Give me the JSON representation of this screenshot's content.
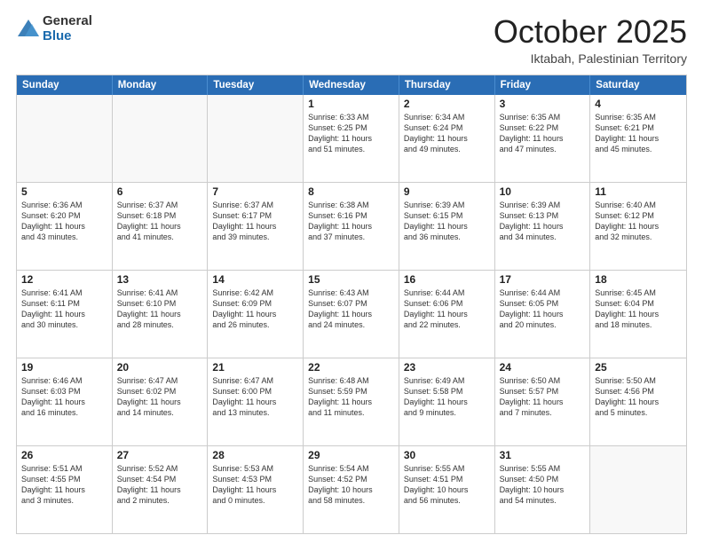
{
  "header": {
    "logo_general": "General",
    "logo_blue": "Blue",
    "month": "October 2025",
    "location": "Iktabah, Palestinian Territory"
  },
  "days_of_week": [
    "Sunday",
    "Monday",
    "Tuesday",
    "Wednesday",
    "Thursday",
    "Friday",
    "Saturday"
  ],
  "weeks": [
    [
      {
        "day": "",
        "empty": true,
        "lines": []
      },
      {
        "day": "",
        "empty": true,
        "lines": []
      },
      {
        "day": "",
        "empty": true,
        "lines": []
      },
      {
        "day": "1",
        "lines": [
          "Sunrise: 6:33 AM",
          "Sunset: 6:25 PM",
          "Daylight: 11 hours",
          "and 51 minutes."
        ]
      },
      {
        "day": "2",
        "lines": [
          "Sunrise: 6:34 AM",
          "Sunset: 6:24 PM",
          "Daylight: 11 hours",
          "and 49 minutes."
        ]
      },
      {
        "day": "3",
        "lines": [
          "Sunrise: 6:35 AM",
          "Sunset: 6:22 PM",
          "Daylight: 11 hours",
          "and 47 minutes."
        ]
      },
      {
        "day": "4",
        "lines": [
          "Sunrise: 6:35 AM",
          "Sunset: 6:21 PM",
          "Daylight: 11 hours",
          "and 45 minutes."
        ]
      }
    ],
    [
      {
        "day": "5",
        "lines": [
          "Sunrise: 6:36 AM",
          "Sunset: 6:20 PM",
          "Daylight: 11 hours",
          "and 43 minutes."
        ]
      },
      {
        "day": "6",
        "lines": [
          "Sunrise: 6:37 AM",
          "Sunset: 6:18 PM",
          "Daylight: 11 hours",
          "and 41 minutes."
        ]
      },
      {
        "day": "7",
        "lines": [
          "Sunrise: 6:37 AM",
          "Sunset: 6:17 PM",
          "Daylight: 11 hours",
          "and 39 minutes."
        ]
      },
      {
        "day": "8",
        "lines": [
          "Sunrise: 6:38 AM",
          "Sunset: 6:16 PM",
          "Daylight: 11 hours",
          "and 37 minutes."
        ]
      },
      {
        "day": "9",
        "lines": [
          "Sunrise: 6:39 AM",
          "Sunset: 6:15 PM",
          "Daylight: 11 hours",
          "and 36 minutes."
        ]
      },
      {
        "day": "10",
        "lines": [
          "Sunrise: 6:39 AM",
          "Sunset: 6:13 PM",
          "Daylight: 11 hours",
          "and 34 minutes."
        ]
      },
      {
        "day": "11",
        "lines": [
          "Sunrise: 6:40 AM",
          "Sunset: 6:12 PM",
          "Daylight: 11 hours",
          "and 32 minutes."
        ]
      }
    ],
    [
      {
        "day": "12",
        "lines": [
          "Sunrise: 6:41 AM",
          "Sunset: 6:11 PM",
          "Daylight: 11 hours",
          "and 30 minutes."
        ]
      },
      {
        "day": "13",
        "lines": [
          "Sunrise: 6:41 AM",
          "Sunset: 6:10 PM",
          "Daylight: 11 hours",
          "and 28 minutes."
        ]
      },
      {
        "day": "14",
        "lines": [
          "Sunrise: 6:42 AM",
          "Sunset: 6:09 PM",
          "Daylight: 11 hours",
          "and 26 minutes."
        ]
      },
      {
        "day": "15",
        "lines": [
          "Sunrise: 6:43 AM",
          "Sunset: 6:07 PM",
          "Daylight: 11 hours",
          "and 24 minutes."
        ]
      },
      {
        "day": "16",
        "lines": [
          "Sunrise: 6:44 AM",
          "Sunset: 6:06 PM",
          "Daylight: 11 hours",
          "and 22 minutes."
        ]
      },
      {
        "day": "17",
        "lines": [
          "Sunrise: 6:44 AM",
          "Sunset: 6:05 PM",
          "Daylight: 11 hours",
          "and 20 minutes."
        ]
      },
      {
        "day": "18",
        "lines": [
          "Sunrise: 6:45 AM",
          "Sunset: 6:04 PM",
          "Daylight: 11 hours",
          "and 18 minutes."
        ]
      }
    ],
    [
      {
        "day": "19",
        "lines": [
          "Sunrise: 6:46 AM",
          "Sunset: 6:03 PM",
          "Daylight: 11 hours",
          "and 16 minutes."
        ]
      },
      {
        "day": "20",
        "lines": [
          "Sunrise: 6:47 AM",
          "Sunset: 6:02 PM",
          "Daylight: 11 hours",
          "and 14 minutes."
        ]
      },
      {
        "day": "21",
        "lines": [
          "Sunrise: 6:47 AM",
          "Sunset: 6:00 PM",
          "Daylight: 11 hours",
          "and 13 minutes."
        ]
      },
      {
        "day": "22",
        "lines": [
          "Sunrise: 6:48 AM",
          "Sunset: 5:59 PM",
          "Daylight: 11 hours",
          "and 11 minutes."
        ]
      },
      {
        "day": "23",
        "lines": [
          "Sunrise: 6:49 AM",
          "Sunset: 5:58 PM",
          "Daylight: 11 hours",
          "and 9 minutes."
        ]
      },
      {
        "day": "24",
        "lines": [
          "Sunrise: 6:50 AM",
          "Sunset: 5:57 PM",
          "Daylight: 11 hours",
          "and 7 minutes."
        ]
      },
      {
        "day": "25",
        "lines": [
          "Sunrise: 5:50 AM",
          "Sunset: 4:56 PM",
          "Daylight: 11 hours",
          "and 5 minutes."
        ]
      }
    ],
    [
      {
        "day": "26",
        "lines": [
          "Sunrise: 5:51 AM",
          "Sunset: 4:55 PM",
          "Daylight: 11 hours",
          "and 3 minutes."
        ]
      },
      {
        "day": "27",
        "lines": [
          "Sunrise: 5:52 AM",
          "Sunset: 4:54 PM",
          "Daylight: 11 hours",
          "and 2 minutes."
        ]
      },
      {
        "day": "28",
        "lines": [
          "Sunrise: 5:53 AM",
          "Sunset: 4:53 PM",
          "Daylight: 11 hours",
          "and 0 minutes."
        ]
      },
      {
        "day": "29",
        "lines": [
          "Sunrise: 5:54 AM",
          "Sunset: 4:52 PM",
          "Daylight: 10 hours",
          "and 58 minutes."
        ]
      },
      {
        "day": "30",
        "lines": [
          "Sunrise: 5:55 AM",
          "Sunset: 4:51 PM",
          "Daylight: 10 hours",
          "and 56 minutes."
        ]
      },
      {
        "day": "31",
        "lines": [
          "Sunrise: 5:55 AM",
          "Sunset: 4:50 PM",
          "Daylight: 10 hours",
          "and 54 minutes."
        ]
      },
      {
        "day": "",
        "empty": true,
        "lines": []
      }
    ]
  ]
}
